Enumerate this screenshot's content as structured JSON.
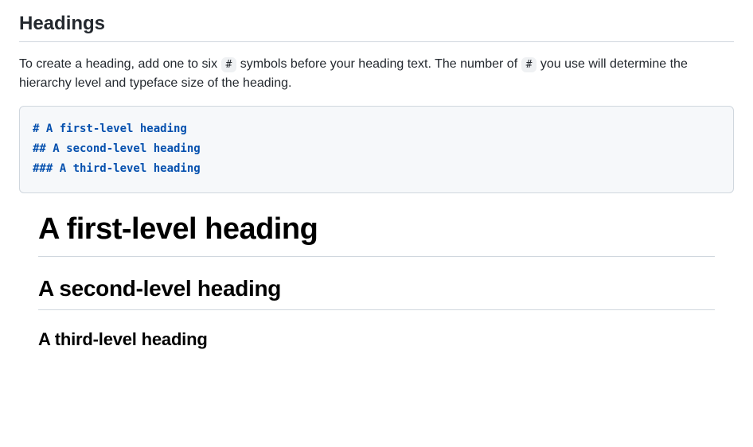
{
  "section": {
    "title": "Headings"
  },
  "description": {
    "part1": "To create a heading, add one to six ",
    "code1": "#",
    "part2": " symbols before your heading text. The number of ",
    "code2": "#",
    "part3": " you use will determine the hierarchy level and typeface size of the heading."
  },
  "codeBlock": {
    "line1": "# A first-level heading",
    "line2": "## A second-level heading",
    "line3": "### A third-level heading"
  },
  "rendered": {
    "h1": "A first-level heading",
    "h2": "A second-level heading",
    "h3": "A third-level heading"
  }
}
